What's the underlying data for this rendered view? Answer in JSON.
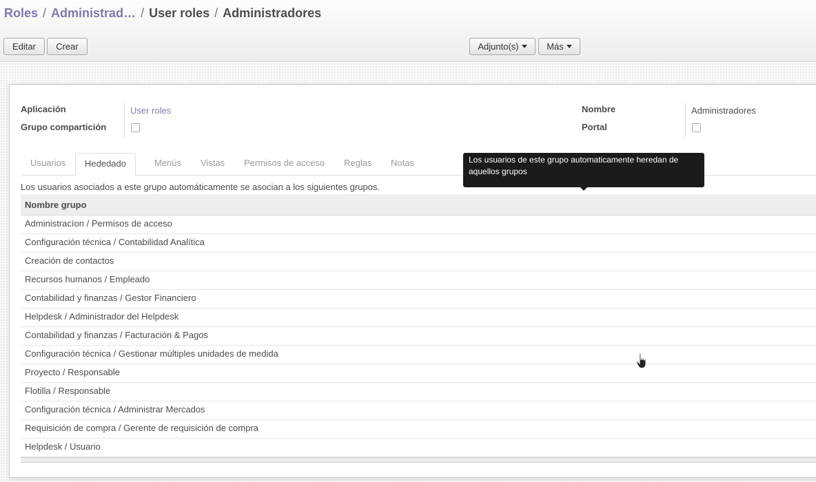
{
  "breadcrumb": {
    "items": [
      "Roles",
      "Administrad…",
      "User roles",
      "Administradores"
    ],
    "separator": "/"
  },
  "toolbar": {
    "edit_label": "Editar",
    "create_label": "Crear",
    "attachments_label": "Adjunto(s)",
    "more_label": "Más"
  },
  "form": {
    "application_label": "Aplicación",
    "application_value": "User roles",
    "share_group_label": "Grupo compartición",
    "share_group_checked": false,
    "name_label": "Nombre",
    "name_value": "Administradores",
    "portal_label": "Portal",
    "portal_checked": false
  },
  "tabs": [
    "Usuarios",
    "Hededado",
    "Menús",
    "Vistas",
    "Permisos de acceso",
    "Reglas",
    "Notas"
  ],
  "active_tab": "Hededado",
  "inherited": {
    "help_text": "Los usuarios asociados a este grupo automáticamente se asocian a los siguientes grupos.",
    "column_header": "Nombre grupo",
    "rows": [
      "Administracíon / Permisos de acceso",
      "Configuración técnica / Contabilidad Analítica",
      "Creación de contactos",
      "Recursos humanos / Empleado",
      "Contabilidad y finanzas / Gestor Financiero",
      "Helpdesk / Administrador del Helpdesk",
      "Contabilidad y finanzas / Facturación & Pagos",
      "Configuración técnica / Gestionar múltiples unidades de medida",
      "Proyecto / Responsable",
      "Flotilla / Responsable",
      "Configuración técnica / Administrar Mercados",
      "Requisición de compra / Gerente de requisición de compra",
      "Helpdesk / Usuario"
    ]
  },
  "tooltip": {
    "text": "Los usuarios de este grupo automaticamente heredan de aquellos grupos"
  },
  "colors": {
    "link": "#7c7bad",
    "text": "#4c4c4c",
    "tooltip_bg": "#1b1b1b"
  },
  "icons": {
    "caret": "caret-down-icon",
    "cursor": "hand-pointer-icon"
  }
}
